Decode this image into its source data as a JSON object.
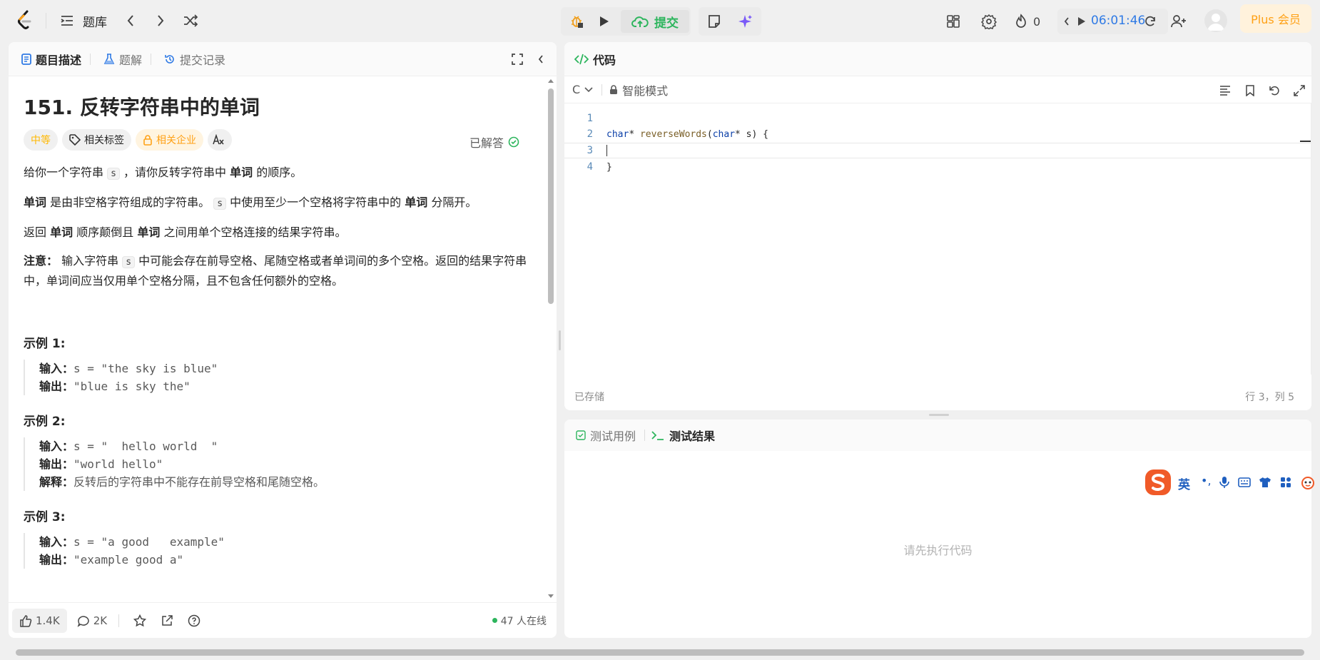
{
  "topbar": {
    "problem_bank": "题库",
    "submit": "提交",
    "fire_count": "0",
    "timer": "06:01:46",
    "plus": "Plus 会员"
  },
  "left": {
    "tabs": [
      "题目描述",
      "题解",
      "提交记录"
    ],
    "title": "151. 反转字符串中的单词",
    "solved": "已解答",
    "tags": [
      "中等",
      "相关标签",
      "相关企业"
    ],
    "desc": {
      "p1a": "给你一个字符串",
      "p1code": "s",
      "p1b": "，请你反转字符串中",
      "p1bold": "单词",
      "p1c": "的顺序。",
      "p2bold": "单词",
      "p2a": "是由非空格字符组成的字符串。",
      "p2code": "s",
      "p2b": "中使用至少一个空格将字符串中的",
      "p2bold2": "单词",
      "p2c": "分隔开。",
      "p3a": "返回",
      "p3bold": "单词",
      "p3b": "顺序颠倒且",
      "p3bold2": "单词",
      "p3c": "之间用单个空格连接的结果字符串。",
      "p4bold": "注意：",
      "p4a": "输入字符串",
      "p4code": "s",
      "p4b": "中可能会存在前导空格、尾随空格或者单词间的多个空格。返回的结果字符串中，单词间应当仅用单个空格分隔，且不包含任何额外的空格。"
    },
    "examples": [
      {
        "title": "示例 1:",
        "in_label": "输入：",
        "input": "s = \"the sky is blue\"",
        "out_label": "输出：",
        "output": "\"blue is sky the\""
      },
      {
        "title": "示例 2:",
        "in_label": "输入：",
        "input": "s = \"  hello world  \"",
        "out_label": "输出：",
        "output": "\"world hello\"",
        "exp_label": "解释：",
        "explain": "反转后的字符串中不能存在前导空格和尾随空格。"
      },
      {
        "title": "示例 3:",
        "in_label": "输入：",
        "input": "s = \"a good   example\"",
        "out_label": "输出：",
        "output": "\"example good a\""
      }
    ],
    "footer": {
      "likes": "1.4K",
      "comments": "2K",
      "online": "47 人在线"
    }
  },
  "code": {
    "header": "代码",
    "language": "C",
    "mode": "智能模式",
    "lines": [
      "1",
      "2",
      "3",
      "4"
    ],
    "line2": {
      "kw1": "char",
      "a": "* ",
      "fn": "reverseWords",
      "b": "(",
      "kw2": "char",
      "c": "* s) {"
    },
    "line4": "}",
    "saved": "已存储",
    "cursor": "行 3，列 5"
  },
  "test": {
    "tabs": [
      "测试用例",
      "测试结果"
    ],
    "empty": "请先执行代码"
  },
  "ime": {
    "lang": "英"
  }
}
